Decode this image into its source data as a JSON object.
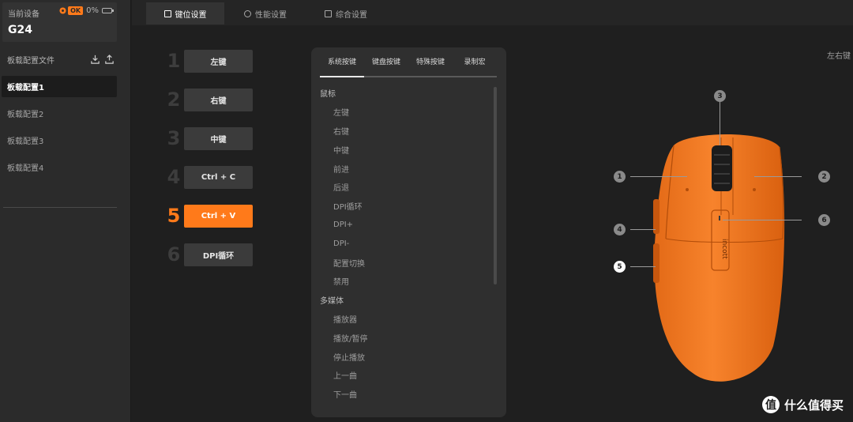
{
  "sidebar": {
    "device_label": "当前设备",
    "device_status_badge": "OK",
    "battery_percent": "0%",
    "device_name": "G24",
    "profile_file_label": "板载配置文件",
    "profiles": [
      {
        "label": "板载配置1",
        "active": true
      },
      {
        "label": "板载配置2",
        "active": false
      },
      {
        "label": "板载配置3",
        "active": false
      },
      {
        "label": "板载配置4",
        "active": false
      }
    ]
  },
  "top_tabs": [
    {
      "label": "键位设置",
      "active": true
    },
    {
      "label": "性能设置",
      "active": false
    },
    {
      "label": "综合设置",
      "active": false
    }
  ],
  "button_assignments": [
    {
      "number": "1",
      "label": "左键",
      "active": false
    },
    {
      "number": "2",
      "label": "右键",
      "active": false
    },
    {
      "number": "3",
      "label": "中键",
      "active": false
    },
    {
      "number": "4",
      "label": "Ctrl + C",
      "active": false
    },
    {
      "number": "5",
      "label": "Ctrl + V",
      "active": true
    },
    {
      "number": "6",
      "label": "DPI循环",
      "active": false
    }
  ],
  "function_panel": {
    "tabs": [
      "系统按键",
      "键盘按键",
      "特殊按键",
      "录制宏"
    ],
    "active_tab": "系统按键",
    "categories": [
      {
        "name": "鼠标",
        "items": [
          "左键",
          "右键",
          "中键",
          "前进",
          "后退",
          "DPI循环",
          "DPI+",
          "DPI-",
          "配置切换",
          "禁用"
        ]
      },
      {
        "name": "多媒体",
        "items": [
          "播放器",
          "播放/暂停",
          "停止播放",
          "上一曲",
          "下一曲"
        ]
      }
    ]
  },
  "corner_label": "左右键",
  "mouse_callouts": [
    "1",
    "2",
    "3",
    "4",
    "5",
    "6"
  ],
  "mouse_logo_text": "incott",
  "watermark": {
    "icon": "值",
    "text": "什么值得买"
  },
  "colors": {
    "accent": "#ff7a1a",
    "mouse_body": "#f7832c",
    "background": "#1f1f1f"
  }
}
